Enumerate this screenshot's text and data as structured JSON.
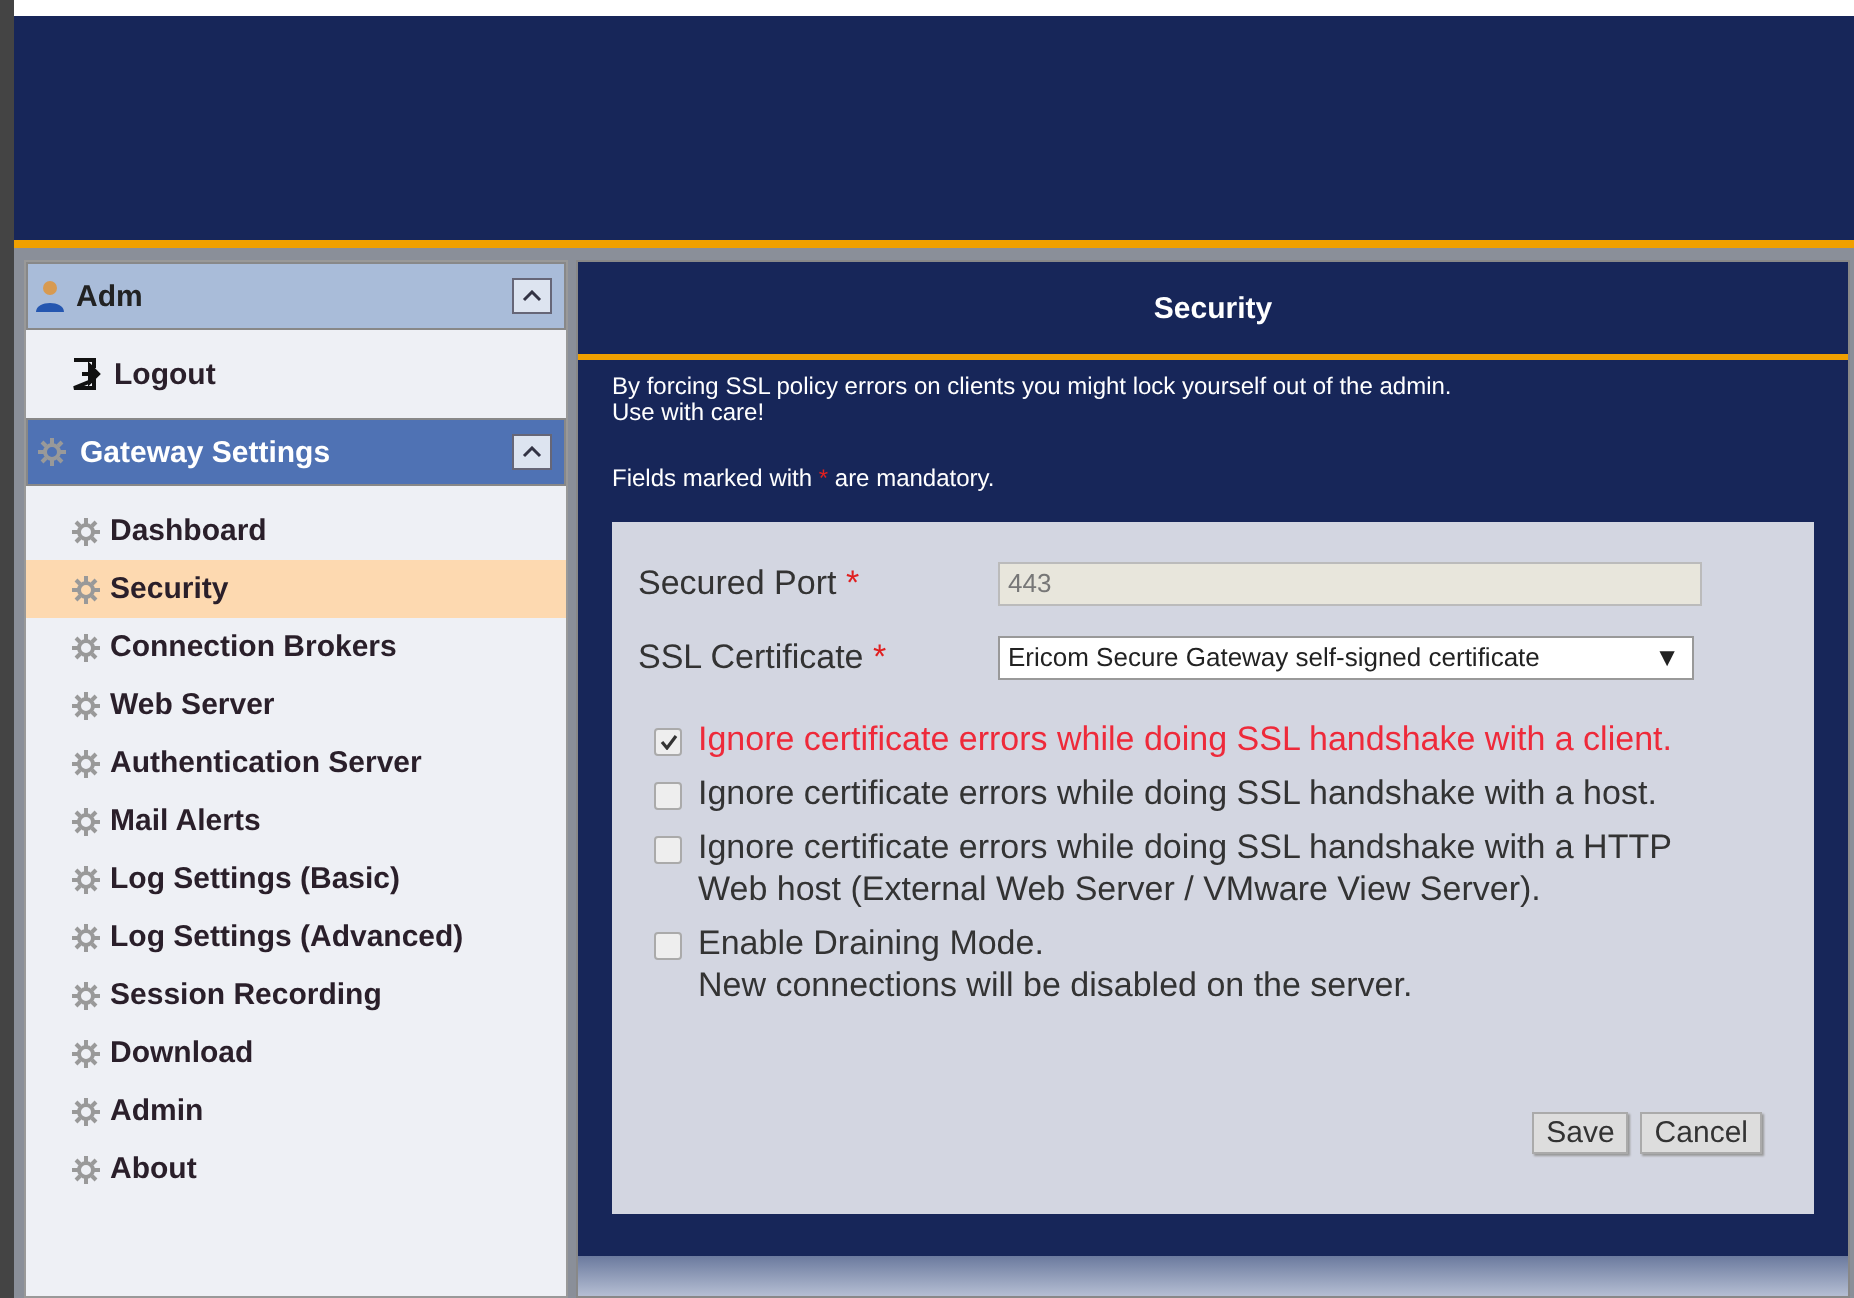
{
  "user_panel": {
    "title": "Adm",
    "expanded": true,
    "items": [
      {
        "label": "Logout"
      }
    ]
  },
  "settings_panel": {
    "title": "Gateway Settings",
    "expanded": true,
    "items": [
      {
        "label": "Dashboard",
        "selected": false
      },
      {
        "label": "Security",
        "selected": true
      },
      {
        "label": "Connection Brokers",
        "selected": false
      },
      {
        "label": "Web Server",
        "selected": false
      },
      {
        "label": "Authentication Server",
        "selected": false
      },
      {
        "label": "Mail Alerts",
        "selected": false
      },
      {
        "label": "Log Settings (Basic)",
        "selected": false
      },
      {
        "label": "Log Settings (Advanced)",
        "selected": false
      },
      {
        "label": "Session Recording",
        "selected": false
      },
      {
        "label": "Download",
        "selected": false
      },
      {
        "label": "Admin",
        "selected": false
      },
      {
        "label": "About",
        "selected": false
      }
    ]
  },
  "page": {
    "title": "Security",
    "warning": [
      "By forcing SSL policy errors on clients you might lock yourself out of the admin.",
      "Use with care!"
    ],
    "mandatory_note": {
      "before": "Fields marked with",
      "star": "*",
      "after": "are mandatory."
    },
    "fields": [
      {
        "kind": "input",
        "label": "Secured Port",
        "star": "*",
        "value": "443"
      },
      {
        "kind": "select",
        "label": "SSL Certificate",
        "star": "*",
        "value": "Ericom Secure Gateway self-signed certificate",
        "caret": "▼"
      }
    ],
    "options": [
      {
        "lines": [
          "Ignore certificate errors while doing SSL handshake with a client."
        ],
        "checked": true
      },
      {
        "lines": [
          "Ignore certificate errors while doing SSL handshake with a host."
        ],
        "checked": false
      },
      {
        "lines": [
          "Ignore certificate errors while doing SSL handshake with a HTTP Web host (External Web Server / VMware View Server)."
        ],
        "checked": false
      },
      {
        "lines": [
          "Enable Draining Mode.",
          "New connections will be disabled on the server."
        ],
        "checked": false
      }
    ],
    "buttons": [
      "Save",
      "Cancel"
    ]
  }
}
